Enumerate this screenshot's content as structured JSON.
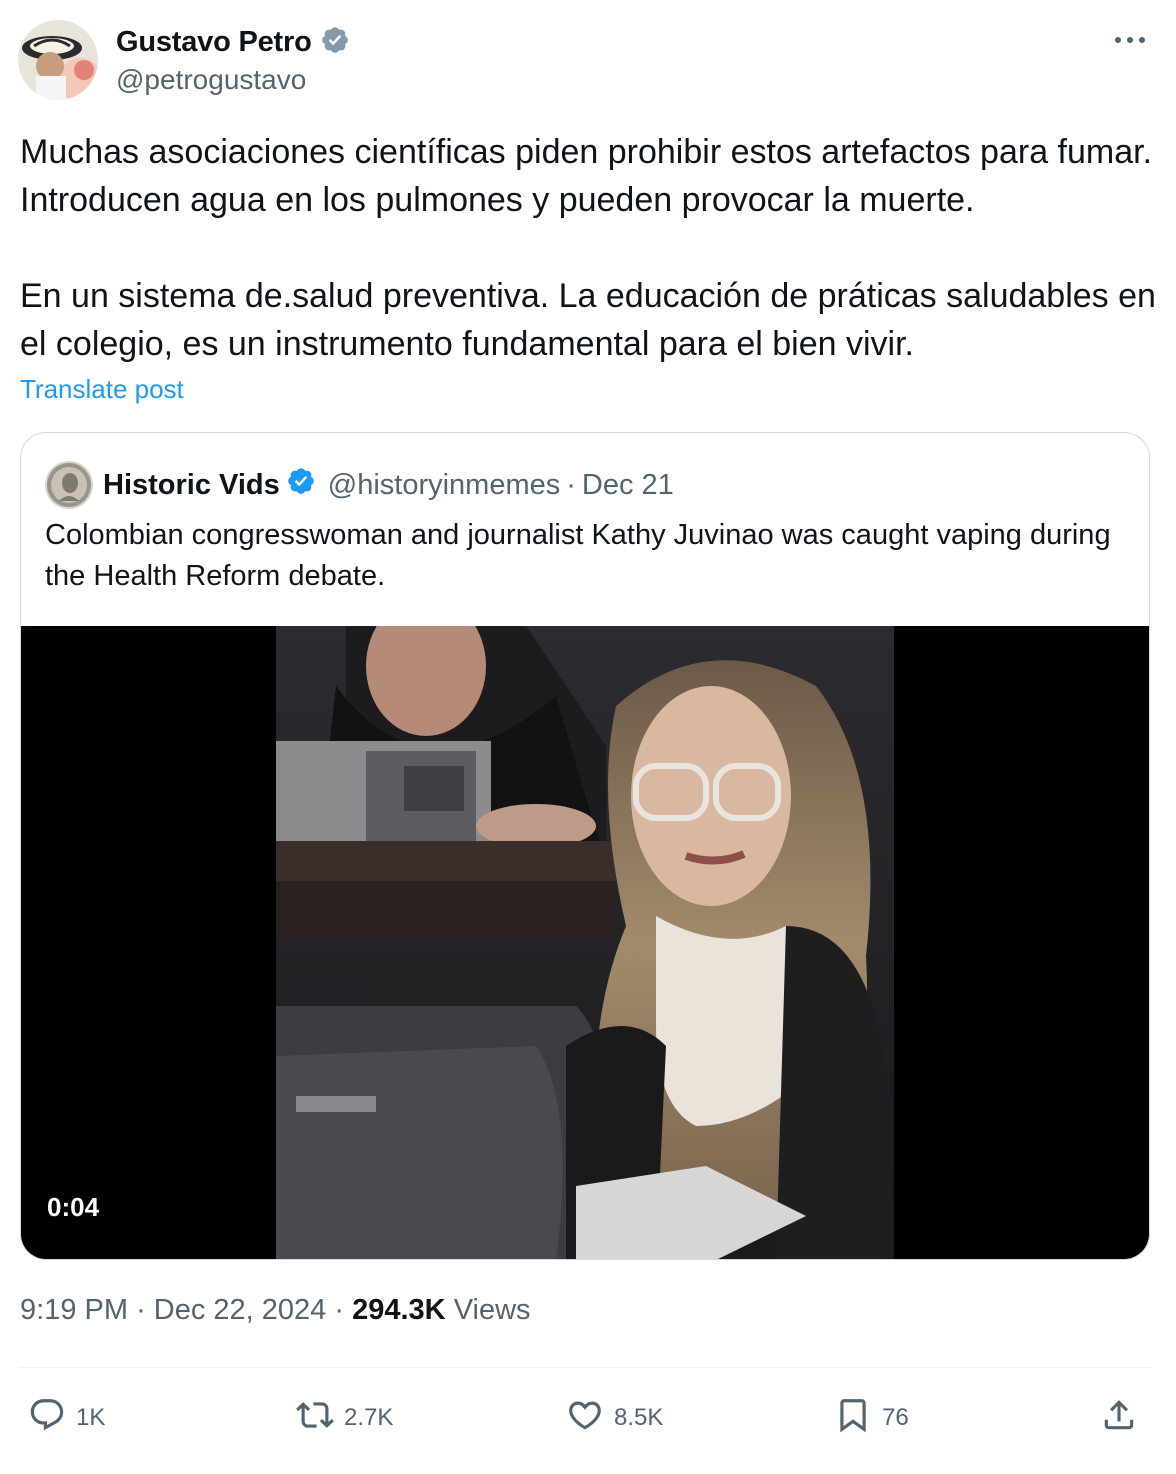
{
  "author": {
    "name": "Gustavo Petro",
    "handle": "@petrogustavo",
    "verified_icon": "verified-badge-gray"
  },
  "tweet": {
    "paragraphs": [
      "Muchas asociaciones científicas piden prohibir estos artefactos para fumar. Introducen agua en los pulmones y pueden provocar la muerte.",
      "En un sistema de.salud preventiva. La educación de práticas saludables en el colegio, es un instrumento fundamental para el bien vivir."
    ],
    "translate_label": "Translate post"
  },
  "quote": {
    "name": "Historic Vids",
    "handle": "@historyinmemes",
    "date": "Dec 21",
    "separator": "·",
    "text": "Colombian congresswoman and journalist Kathy Juvinao was caught vaping during the Health Reform debate.",
    "video_duration": "0:04",
    "verified_icon": "verified-badge-blue"
  },
  "meta": {
    "time": "9:19 PM",
    "date": "Dec 22, 2024",
    "separator": "·",
    "views_count": "294.3K",
    "views_label": "Views"
  },
  "actions": {
    "replies": "1K",
    "reposts": "2.7K",
    "likes": "8.5K",
    "bookmarks": "76"
  },
  "colors": {
    "text": "#0f1419",
    "secondary": "#536471",
    "link": "#1d9bf0",
    "border": "#cfd9de",
    "verified_gray": "#829aab",
    "verified_blue": "#1d9bf0"
  }
}
